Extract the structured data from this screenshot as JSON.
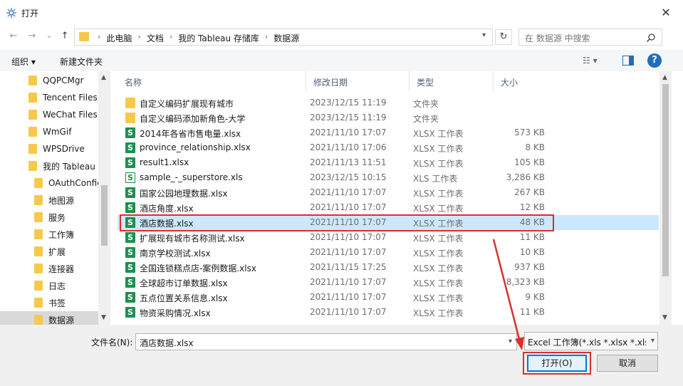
{
  "window": {
    "title": "打开",
    "close_glyph": "✕"
  },
  "nav": {
    "back": "←",
    "forward": "→",
    "recent": "⌄",
    "up": "↑"
  },
  "address": {
    "breadcrumbs": [
      "此电脑",
      "文档",
      "我的 Tableau 存储库",
      "数据源"
    ],
    "refresh_glyph": "↻"
  },
  "search": {
    "placeholder": "在 数据源 中搜索",
    "icon": "search-icon"
  },
  "toolbar": {
    "organize": "组织 ▾",
    "new_folder": "新建文件夹",
    "view_glyph": "☷ ▾",
    "help": "?"
  },
  "sidebar": {
    "items": [
      "QQPCMgr",
      "Tencent Files",
      "WeChat Files",
      "WmGif",
      "WPSDrive",
      "我的 Tableau",
      "OAuthConfig",
      "地图源",
      "服务",
      "工作簿",
      "扩展",
      "连接器",
      "日志",
      "书签",
      "数据源"
    ],
    "selected": "数据源"
  },
  "columns": {
    "name": "名称",
    "date": "修改日期",
    "type": "类型",
    "size": "大小"
  },
  "files": [
    {
      "name": "自定义编码扩展现有城市",
      "date": "2023/12/15 11:19",
      "type": "文件夹",
      "size": "",
      "icon": "folder"
    },
    {
      "name": "自定义编码添加新角色-大学",
      "date": "2023/12/15 11:19",
      "type": "文件夹",
      "size": "",
      "icon": "folder"
    },
    {
      "name": "2014年各省市售电量.xlsx",
      "date": "2021/11/10 17:07",
      "type": "XLSX 工作表",
      "size": "573 KB",
      "icon": "xlsx"
    },
    {
      "name": "province_relationship.xlsx",
      "date": "2021/11/10 17:06",
      "type": "XLSX 工作表",
      "size": "8 KB",
      "icon": "xlsx"
    },
    {
      "name": "result1.xlsx",
      "date": "2021/11/13 11:51",
      "type": "XLSX 工作表",
      "size": "105 KB",
      "icon": "xlsx"
    },
    {
      "name": "sample_-_superstore.xls",
      "date": "2023/12/15 10:15",
      "type": "XLS 工作表",
      "size": "3,286 KB",
      "icon": "xls"
    },
    {
      "name": "国家公园地理数据.xlsx",
      "date": "2021/11/10 17:07",
      "type": "XLSX 工作表",
      "size": "267 KB",
      "icon": "xlsx"
    },
    {
      "name": "酒店角度.xlsx",
      "date": "2021/11/10 17:07",
      "type": "XLSX 工作表",
      "size": "12 KB",
      "icon": "xlsx"
    },
    {
      "name": "酒店数据.xlsx",
      "date": "2021/11/10 17:07",
      "type": "XLSX 工作表",
      "size": "48 KB",
      "icon": "xlsx",
      "selected": true
    },
    {
      "name": "扩展现有城市名称测试.xlsx",
      "date": "2021/11/10 17:07",
      "type": "XLSX 工作表",
      "size": "11 KB",
      "icon": "xlsx"
    },
    {
      "name": "南京学校测试.xlsx",
      "date": "2021/11/10 17:07",
      "type": "XLSX 工作表",
      "size": "10 KB",
      "icon": "xlsx"
    },
    {
      "name": "全国连锁糕点店-案例数据.xlsx",
      "date": "2021/11/15 17:25",
      "type": "XLSX 工作表",
      "size": "937 KB",
      "icon": "xlsx"
    },
    {
      "name": "全球超市订单数据.xlsx",
      "date": "2021/11/10 17:07",
      "type": "XLSX 工作表",
      "size": "8,323 KB",
      "icon": "xlsx"
    },
    {
      "name": "五点位置关系信息.xlsx",
      "date": "2021/11/10 17:07",
      "type": "XLSX 工作表",
      "size": "9 KB",
      "icon": "xlsx"
    },
    {
      "name": "物资采购情况.xlsx",
      "date": "2021/11/10 17:07",
      "type": "XLSX 工作表",
      "size": "11 KB",
      "icon": "xlsx"
    }
  ],
  "icon_glyphs": {
    "xlsx": "S",
    "xls": "S"
  },
  "filename": {
    "label": "文件名(N):",
    "value": "酒店数据.xlsx"
  },
  "filetype": {
    "value": "Excel 工作簿(*.xls *.xlsx *.xlsm"
  },
  "buttons": {
    "open": "打开(O)",
    "cancel": "取消"
  },
  "scroll_glyphs": {
    "up": "▲",
    "down": "▼"
  },
  "accent_colors": {
    "selection": "#cce8ff",
    "highlight_frame": "#d9302c",
    "xlsx_green": "#1e8f4e",
    "folder": "#f6c94a"
  }
}
